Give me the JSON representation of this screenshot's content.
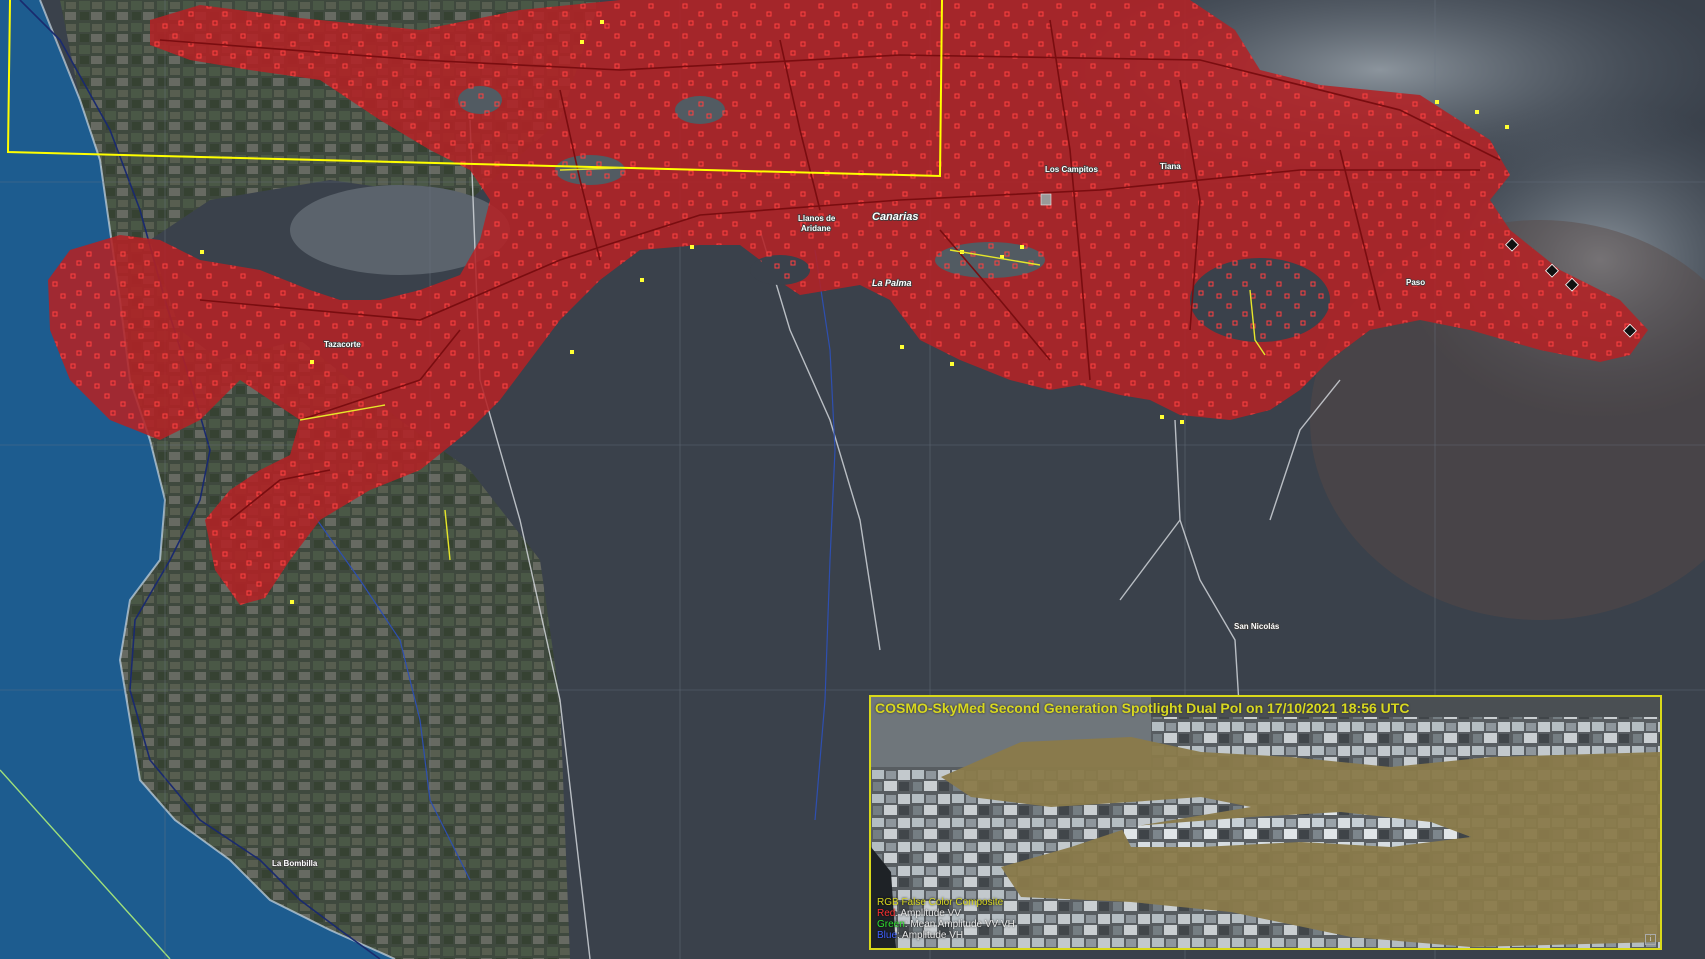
{
  "map": {
    "places": {
      "canarias": "Canarias",
      "la_palma": "La Palma",
      "llanos_1": "Llanos de",
      "llanos_2": "Aridane",
      "los_campitos": "Los Campitos",
      "tiana": "Tiana",
      "paso": "Paso",
      "tazacorte": "Tazacorte",
      "san_nicolas": "San Nicolás",
      "la_bombilla": "La Bombilla"
    },
    "colors": {
      "lava_flow": "#b32226",
      "affected_marker": "#ff3333",
      "aoi_outline": "#ffff00",
      "sea": "#1d5c8f",
      "land": "#3a414b"
    }
  },
  "inset": {
    "title": "COSMO-SkyMed Second Generation Spotlight Dual Pol on 17/10/2021 18:56 UTC",
    "legend": {
      "title": "RGB False Color Composite",
      "red_key": "Red",
      "red_value": ": Amplitude VV",
      "green_key": "Green",
      "green_value": ": Mean Amplitude VV-VH",
      "blue_key": "Blue",
      "blue_value": ": Amplitude VH"
    },
    "info_mark": "i"
  }
}
